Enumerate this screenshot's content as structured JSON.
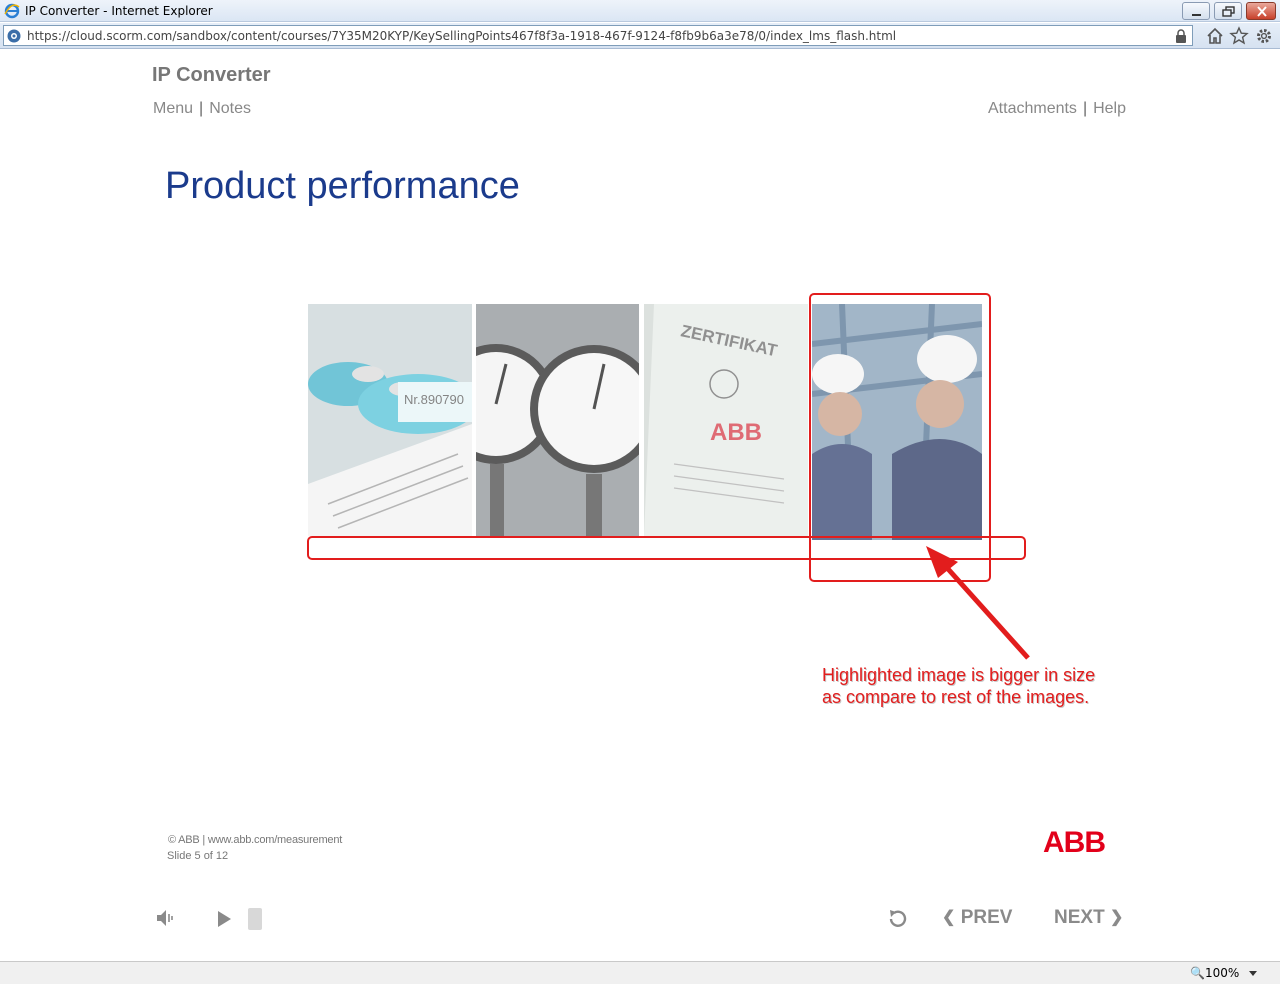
{
  "browser": {
    "window_title": "IP Converter - Internet Explorer",
    "url": "https://cloud.scorm.com/sandbox/content/courses/7Y35M20KYP/KeySellingPoints467f8f3a-1918-467f-9124-f8fb9b6a3e78/0/index_lms_flash.html",
    "zoom": "100%"
  },
  "course": {
    "title": "IP Converter",
    "nav_left": [
      "Menu",
      "Notes"
    ],
    "nav_right": [
      "Attachments",
      "Help"
    ],
    "separator": "|"
  },
  "slide": {
    "title": "Product performance",
    "images": [
      {
        "name": "transmitter-photo",
        "printed_text": "Nr.890790"
      },
      {
        "name": "pressure-gauges-photo"
      },
      {
        "name": "certificate-photo",
        "printed_text": "ZERTIFIKAT"
      },
      {
        "name": "engineers-photo"
      }
    ]
  },
  "annotation": {
    "line1": "Highlighted image is bigger in size",
    "line2": "as compare to rest of the images.",
    "color": "#e21d1d"
  },
  "footer": {
    "copyright": "© ABB | www.abb.com/measurement",
    "slide_counter": "Slide 5 of 12",
    "logo_text": "ABB",
    "logo_color": "#e2001a"
  },
  "controls": {
    "prev_label": "PREV",
    "next_label": "NEXT",
    "icons": [
      "speaker-icon",
      "play-icon",
      "replay-icon"
    ]
  }
}
